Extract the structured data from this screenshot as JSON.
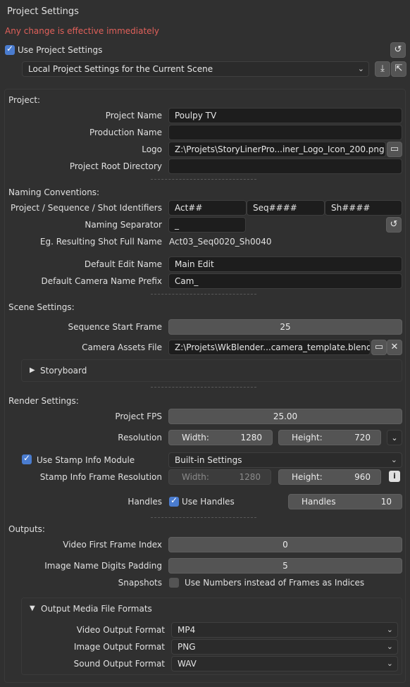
{
  "header": {
    "title": "Project Settings",
    "warning": "Any change is effective immediately"
  },
  "colors": {
    "warning": "#e0605a",
    "accent": "#4a7ccf"
  },
  "use_project": {
    "label": "Use Project Settings",
    "checked": true,
    "preset": "Local Project Settings for the Current Scene"
  },
  "project": {
    "section": "Project:",
    "name_label": "Project Name",
    "name_value": "Poulpy TV",
    "production_label": "Production Name",
    "production_value": "",
    "logo_label": "Logo",
    "logo_value": "Z:\\Projets\\StoryLinerPro...iner_Logo_Icon_200.png",
    "root_label": "Project Root Directory",
    "root_value": ""
  },
  "naming": {
    "section": "Naming Conventions:",
    "ids_label": "Project / Sequence / Shot Identifiers",
    "act": "Act##",
    "seq": "Seq####",
    "shot": "Sh####",
    "separator_label": "Naming Separator",
    "separator_value": "_",
    "example_label": "Eg. Resulting Shot Full Name",
    "example_value": "Act03_Seq0020_Sh0040",
    "edit_label": "Default Edit Name",
    "edit_value": "Main Edit",
    "camera_label": "Default Camera Name Prefix",
    "camera_value": "Cam_"
  },
  "scene": {
    "section": "Scene Settings:",
    "start_label": "Sequence Start Frame",
    "start_value": "25",
    "assets_label": "Camera Assets File",
    "assets_value": "Z:\\Projets\\WkBlender...camera_template.blend",
    "storyboard": "Storyboard"
  },
  "render": {
    "section": "Render Settings:",
    "fps_label": "Project FPS",
    "fps_value": "25.00",
    "res_label": "Resolution",
    "width_key": "Width:",
    "width_value": "1280",
    "height_key": "Height:",
    "height_value": "720",
    "stamp_label": "Use Stamp Info Module",
    "stamp_checked": true,
    "stamp_mode": "Built-in Settings",
    "stamp_res_label": "Stamp Info Frame Resolution",
    "stamp_width_value": "1280",
    "stamp_height_value": "960",
    "handles_label": "Handles",
    "use_handles_label": "Use Handles",
    "use_handles_checked": true,
    "handles_key": "Handles",
    "handles_value": "10"
  },
  "outputs": {
    "section": "Outputs:",
    "video_first_label": "Video First Frame Index",
    "video_first_value": "0",
    "padding_label": "Image Name Digits Padding",
    "padding_value": "5",
    "snapshots_label": "Snapshots",
    "snapshots_option": "Use Numbers instead of Frames as Indices",
    "snapshots_checked": false,
    "formats_panel": "Output Media File Formats",
    "video_format_label": "Video Output Format",
    "video_format_value": "MP4",
    "image_format_label": "Image Output Format",
    "image_format_value": "PNG",
    "sound_format_label": "Sound Output Format",
    "sound_format_value": "WAV"
  },
  "icons": {
    "reset": "reset-icon",
    "import": "import-icon",
    "export": "export-icon",
    "folder": "folder-icon",
    "clear": "close-icon",
    "info": "info-icon",
    "chevron": "chevron-down-icon",
    "expand": "triangle-right-icon",
    "collapse": "triangle-down-icon"
  }
}
